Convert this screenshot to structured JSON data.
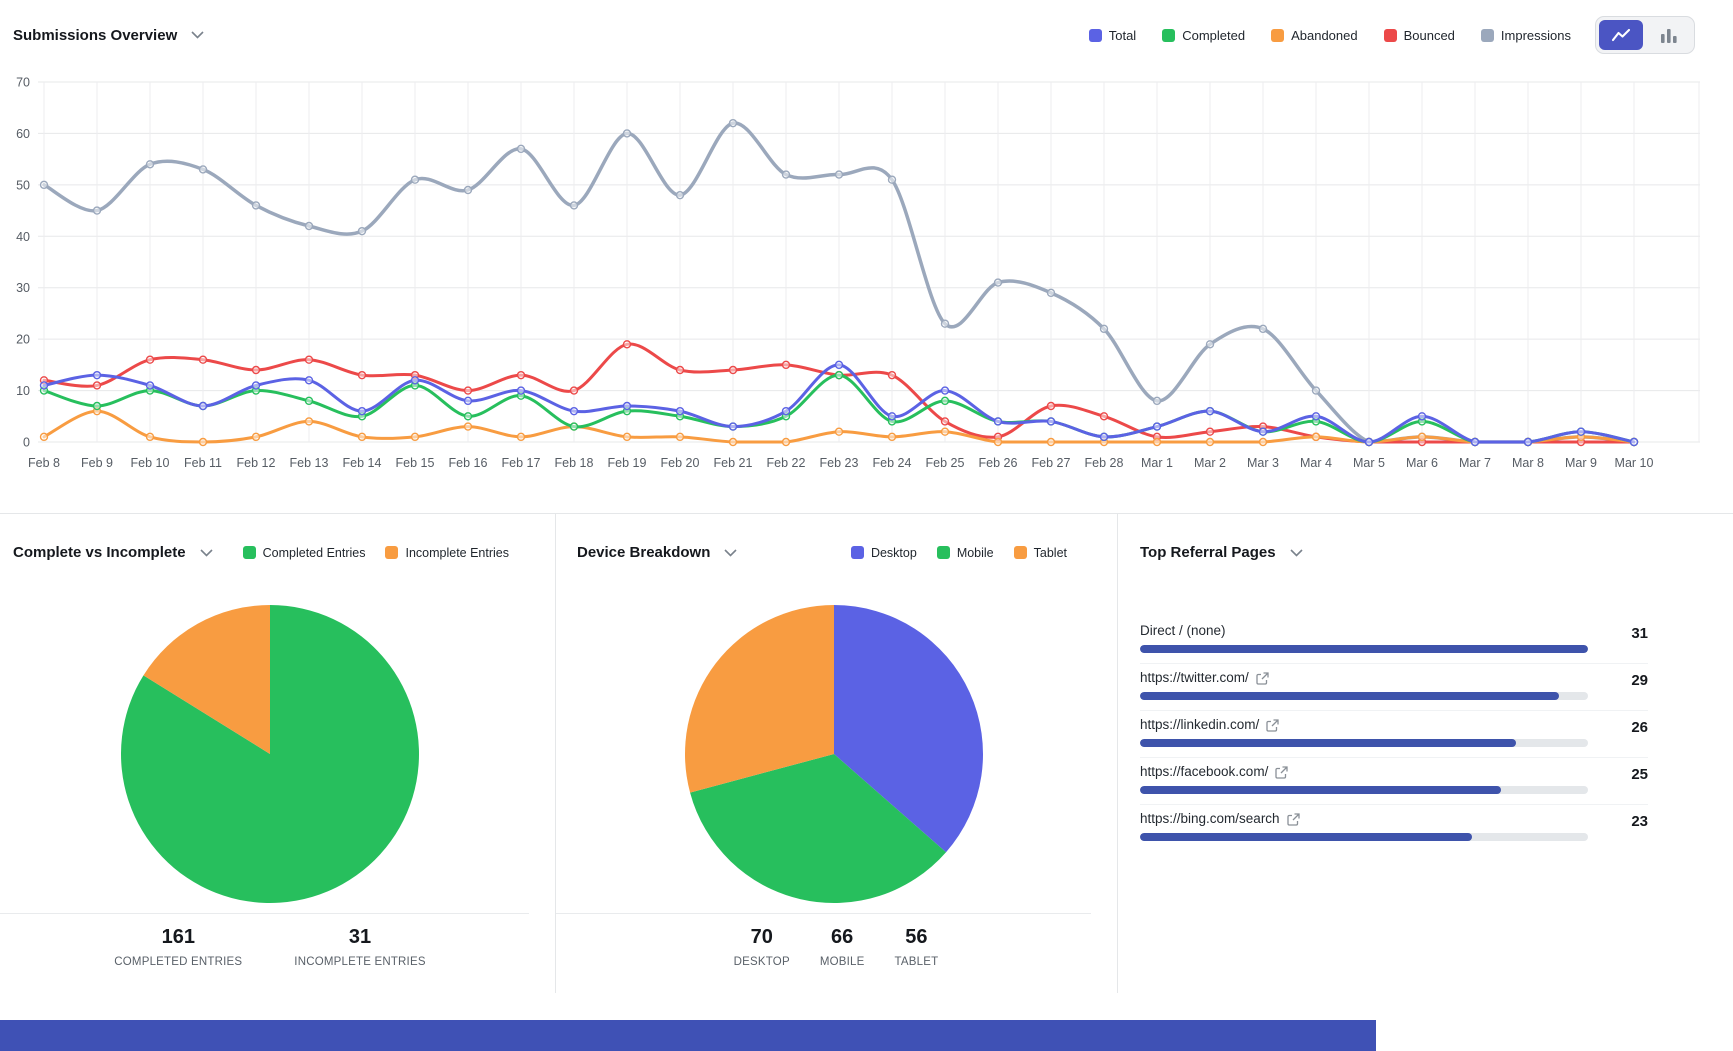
{
  "colors": {
    "total_blue": "#5b62e4",
    "completed_green": "#27bf5d",
    "abandoned_orange": "#f89c41",
    "bounced_red": "#ec4949",
    "impressions_gray": "#9ba8bc",
    "referral_bar_indigo": "#3e53ab",
    "referral_track_gray": "#e4e7ea",
    "footer_bar_blue": "#3f51b5",
    "toggle_active_indigo": "#4b55c3"
  },
  "top_chart": {
    "title": "Submissions Overview",
    "legend": [
      {
        "label": "Total",
        "color": "#5b62e4"
      },
      {
        "label": "Completed",
        "color": "#27bf5d"
      },
      {
        "label": "Abandoned",
        "color": "#f89c41"
      },
      {
        "label": "Bounced",
        "color": "#ec4949"
      },
      {
        "label": "Impressions",
        "color": "#9ba8bc"
      }
    ],
    "chart_type_toggle": {
      "active": "line-chart",
      "options": [
        "line-chart",
        "bar-chart"
      ]
    }
  },
  "chart_data": [
    {
      "type": "line",
      "title": "Submissions Overview",
      "x": [
        "Feb 8",
        "Feb 9",
        "Feb 10",
        "Feb 11",
        "Feb 12",
        "Feb 13",
        "Feb 14",
        "Feb 15",
        "Feb 16",
        "Feb 17",
        "Feb 18",
        "Feb 19",
        "Feb 20",
        "Feb 21",
        "Feb 22",
        "Feb 23",
        "Feb 24",
        "Feb 25",
        "Feb 26",
        "Feb 27",
        "Feb 28",
        "Mar 1",
        "Mar 2",
        "Mar 3",
        "Mar 4",
        "Mar 5",
        "Mar 6",
        "Mar 7",
        "Mar 8",
        "Mar 9",
        "Mar 10"
      ],
      "ylim": [
        0,
        70
      ],
      "ytick_step": 10,
      "grid": true,
      "legend_position": "top-right",
      "series": [
        {
          "name": "Total",
          "color": "#5b62e4",
          "width": 3,
          "values": [
            11,
            13,
            11,
            7,
            11,
            12,
            6,
            12,
            8,
            10,
            6,
            7,
            6,
            3,
            6,
            15,
            5,
            10,
            4,
            4,
            1,
            3,
            6,
            2,
            5,
            0,
            5,
            0,
            0,
            2,
            0
          ]
        },
        {
          "name": "Completed",
          "color": "#27bf5d",
          "width": 3,
          "values": [
            10,
            7,
            10,
            7,
            10,
            8,
            5,
            11,
            5,
            9,
            3,
            6,
            5,
            3,
            5,
            13,
            4,
            8,
            4,
            4,
            1,
            3,
            6,
            2,
            4,
            0,
            4,
            0,
            0,
            2,
            0
          ]
        },
        {
          "name": "Abandoned",
          "color": "#f89c41",
          "width": 3,
          "values": [
            1,
            6,
            1,
            0,
            1,
            4,
            1,
            1,
            3,
            1,
            3,
            1,
            1,
            0,
            0,
            2,
            1,
            2,
            0,
            0,
            0,
            0,
            0,
            0,
            1,
            0,
            1,
            0,
            0,
            1,
            0
          ]
        },
        {
          "name": "Bounced",
          "color": "#ec4949",
          "width": 3,
          "values": [
            12,
            11,
            16,
            16,
            14,
            16,
            13,
            13,
            10,
            13,
            10,
            19,
            14,
            14,
            15,
            13,
            13,
            4,
            1,
            7,
            5,
            1,
            2,
            3,
            1,
            0,
            0,
            0,
            0,
            0,
            0
          ]
        },
        {
          "name": "Impressions",
          "color": "#9ba8bc",
          "width": 3.5,
          "values": [
            50,
            45,
            54,
            53,
            46,
            42,
            41,
            51,
            49,
            57,
            46,
            60,
            48,
            62,
            52,
            52,
            51,
            23,
            31,
            29,
            22,
            8,
            19,
            22,
            10,
            0,
            1,
            0,
            0,
            1,
            0
          ]
        }
      ],
      "draw_order": [
        "Impressions",
        "Bounced",
        "Abandoned",
        "Completed",
        "Total"
      ]
    },
    {
      "type": "pie",
      "title": "Complete vs Incomplete",
      "labels": [
        "Completed Entries",
        "Incomplete Entries"
      ],
      "values": [
        161,
        31
      ],
      "colors": [
        "#27bf5d",
        "#f89c41"
      ],
      "start_angle_deg": -90,
      "direction": "clockwise"
    },
    {
      "type": "pie",
      "title": "Device Breakdown",
      "labels": [
        "Desktop",
        "Mobile",
        "Tablet"
      ],
      "values": [
        70,
        66,
        56
      ],
      "colors": [
        "#5b62e4",
        "#27bf5d",
        "#f89c41"
      ],
      "start_angle_deg": -90,
      "direction": "clockwise"
    },
    {
      "type": "bar",
      "title": "Top Referral Pages",
      "orientation": "horizontal",
      "categories": [
        "Direct / (none)",
        "https://twitter.com/",
        "https://linkedin.com/",
        "https://facebook.com/",
        "https://bing.com/search"
      ],
      "values": [
        31,
        29,
        26,
        25,
        23
      ],
      "xlim": [
        0,
        31
      ]
    }
  ],
  "panels": {
    "complete_vs_incomplete": {
      "title": "Complete vs Incomplete",
      "legend": [
        {
          "label": "Completed Entries",
          "color": "#27bf5d"
        },
        {
          "label": "Incomplete Entries",
          "color": "#f89c41"
        }
      ],
      "stats": [
        {
          "value": "161",
          "label": "COMPLETED ENTRIES"
        },
        {
          "value": "31",
          "label": "INCOMPLETE ENTRIES"
        }
      ]
    },
    "device_breakdown": {
      "title": "Device Breakdown",
      "legend": [
        {
          "label": "Desktop",
          "color": "#5b62e4"
        },
        {
          "label": "Mobile",
          "color": "#27bf5d"
        },
        {
          "label": "Tablet",
          "color": "#f89c41"
        }
      ],
      "stats": [
        {
          "value": "70",
          "label": "DESKTOP"
        },
        {
          "value": "66",
          "label": "MOBILE"
        },
        {
          "value": "56",
          "label": "TABLET"
        }
      ]
    },
    "top_referral_pages": {
      "title": "Top Referral Pages",
      "items": [
        {
          "label": "Direct / (none)",
          "external_link": false,
          "value": 31
        },
        {
          "label": "https://twitter.com/",
          "external_link": true,
          "value": 29
        },
        {
          "label": "https://linkedin.com/",
          "external_link": true,
          "value": 26
        },
        {
          "label": "https://facebook.com/",
          "external_link": true,
          "value": 25
        },
        {
          "label": "https://bing.com/search",
          "external_link": true,
          "value": 23
        }
      ],
      "max_value": 31
    }
  }
}
